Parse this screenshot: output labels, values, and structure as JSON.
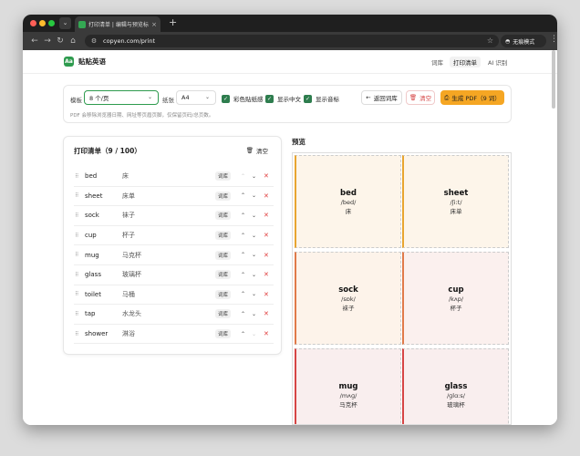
{
  "browser": {
    "tab_title": "打印清单 | 编辑与预览标签 - 贴",
    "url": "copyen.com/print",
    "incognito_label": "无痕模式"
  },
  "site": {
    "logo_text": "Aa",
    "brand": "贴贴英语",
    "nav": [
      {
        "label": "词库",
        "active": false
      },
      {
        "label": "打印清单",
        "active": true
      },
      {
        "label": "AI 识别",
        "active": false
      }
    ]
  },
  "settings": {
    "template_label": "模板",
    "template_value": "8 个/页",
    "paper_label": "纸张",
    "paper_value": "A4",
    "options": [
      {
        "label": "彩色贴纸感",
        "checked": true
      },
      {
        "label": "显示中文",
        "checked": true
      },
      {
        "label": "显示音标",
        "checked": true
      }
    ],
    "back_button": "返回词库",
    "clear_button": "清空",
    "generate_button": "生成 PDF（9 词）",
    "hint": "PDF 会移除浏览器日期、网址等页眉页脚，仅保留页码/总页数。"
  },
  "print_list": {
    "title": "打印清单（9 / 100）",
    "clear_label": "清空",
    "tag_label": "词库",
    "items": [
      {
        "word": "bed",
        "cn": "床"
      },
      {
        "word": "sheet",
        "cn": "床单"
      },
      {
        "word": "sock",
        "cn": "袜子"
      },
      {
        "word": "cup",
        "cn": "杯子"
      },
      {
        "word": "mug",
        "cn": "马克杯"
      },
      {
        "word": "glass",
        "cn": "玻璃杯"
      },
      {
        "word": "toilet",
        "cn": "马桶"
      },
      {
        "word": "tap",
        "cn": "水龙头"
      },
      {
        "word": "shower",
        "cn": "淋浴"
      }
    ]
  },
  "preview": {
    "title": "预览",
    "cards": [
      {
        "word": "bed",
        "phonetic": "/bed/",
        "cn": "床",
        "bg": "#fdf5ea",
        "accent": "#e8a530"
      },
      {
        "word": "sheet",
        "phonetic": "/ʃiːt/",
        "cn": "床单",
        "bg": "#fdf5ea",
        "accent": "#e8a530"
      },
      {
        "word": "sock",
        "phonetic": "/sɒk/",
        "cn": "袜子",
        "bg": "#fdf3ea",
        "accent": "#e07a4a"
      },
      {
        "word": "cup",
        "phonetic": "/kʌp/",
        "cn": "杯子",
        "bg": "#fbf0ee",
        "accent": "#e07a4a"
      },
      {
        "word": "mug",
        "phonetic": "/mʌɡ/",
        "cn": "马克杯",
        "bg": "#f9eeee",
        "accent": "#d64545"
      },
      {
        "word": "glass",
        "phonetic": "/ɡlɑːs/",
        "cn": "玻璃杯",
        "bg": "#f9eeee",
        "accent": "#d64545"
      }
    ]
  }
}
